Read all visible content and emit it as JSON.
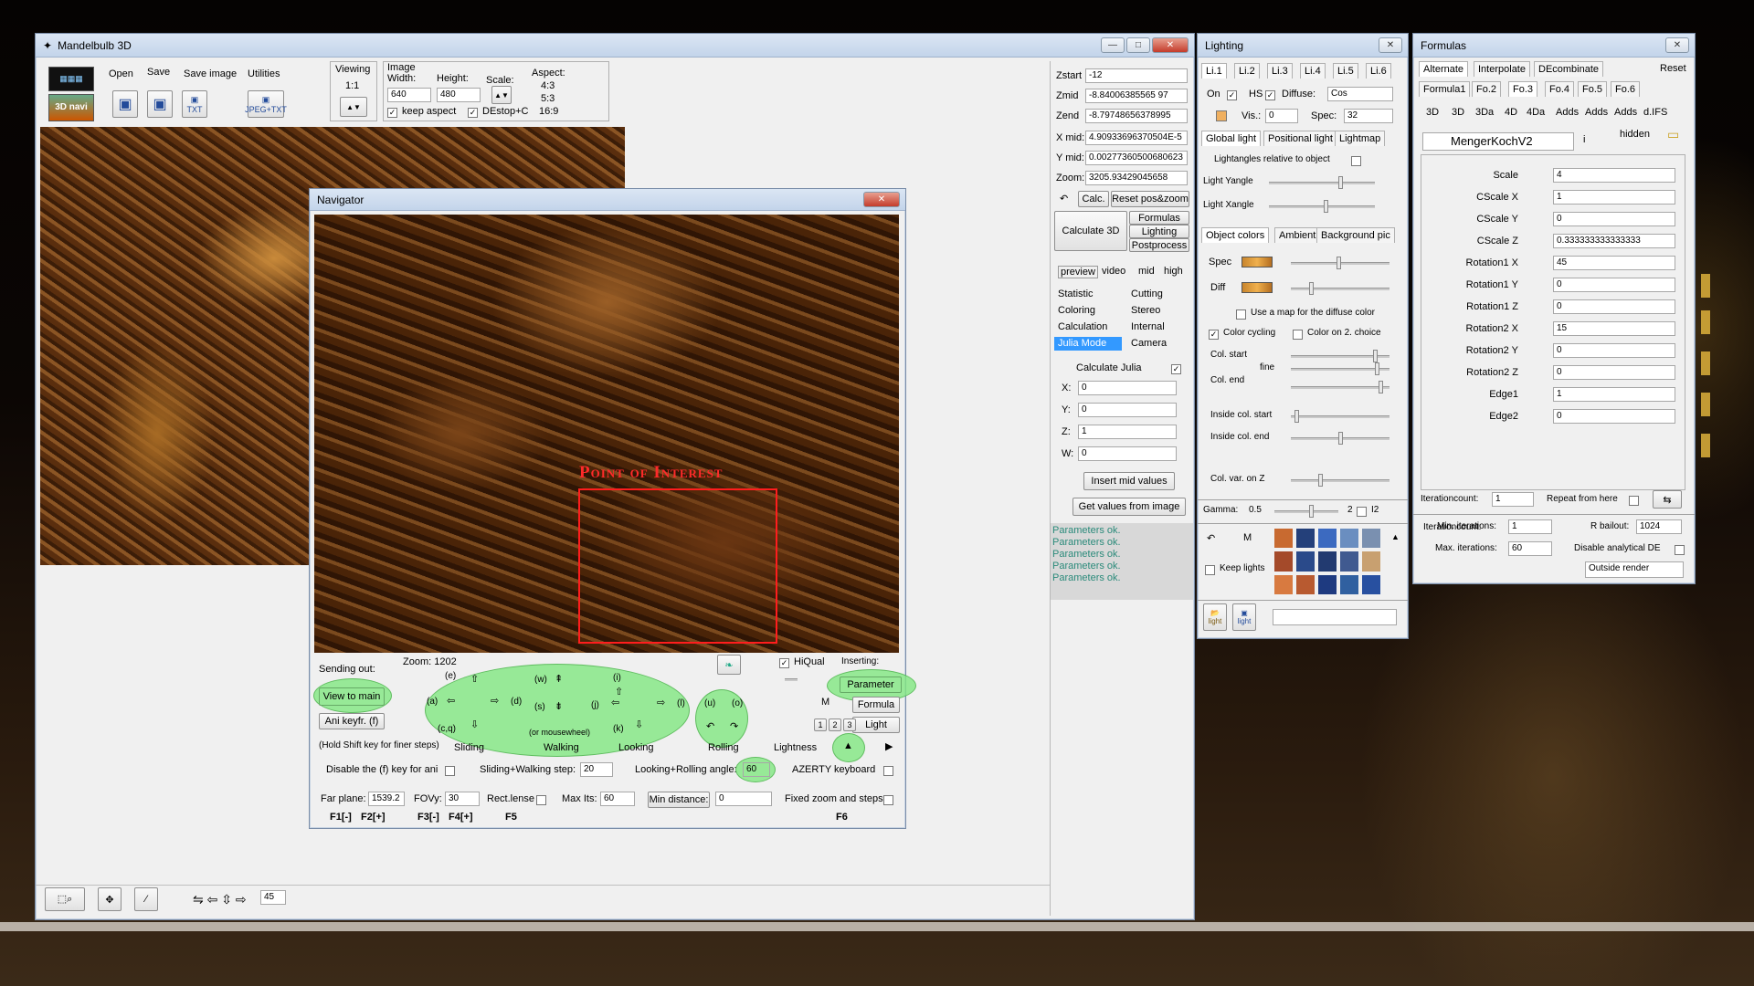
{
  "main": {
    "title": "Mandelbulb 3D",
    "menu": [
      "Open",
      "Save",
      "Save image",
      "Utilities"
    ],
    "viewing_label": "Viewing",
    "viewing_ratio": "1:1",
    "image": {
      "label": "Image",
      "width_label": "Width:",
      "height_label": "Height:",
      "scale_label": "Scale:",
      "aspect_label": "Aspect:",
      "width": "640",
      "height": "480",
      "aspects": [
        "4:3",
        "5:3",
        "16:9"
      ],
      "keep_aspect": "keep aspect",
      "desktop": "DEstop+C"
    },
    "small_icon_labels": [
      "TXT",
      "JPEG+TXT"
    ],
    "bottom_value": "45"
  },
  "coords": {
    "zstart_label": "Zstart",
    "zstart": "-12",
    "zmid_label": "Zmid",
    "zmid": "-8.84006385565 97",
    "zend_label": "Zend",
    "zend": "-8.79748656378995",
    "xmid_label": "X mid:",
    "xmid": "4.90933696370504E-5",
    "ymid_label": "Y mid:",
    "ymid": "0.00277360500680623",
    "zoom_label": "Zoom:",
    "zoom": "3205.93429045658",
    "calc": "Calc.",
    "reset": "Reset pos&zoom",
    "calc3d": "Calculate 3D",
    "side_buttons": [
      "Formulas",
      "Lighting",
      "Postprocess"
    ],
    "quality": [
      "preview",
      "video",
      "mid",
      "high"
    ],
    "tabs_left": [
      "Statistic",
      "Coloring",
      "Calculation",
      "Julia Mode"
    ],
    "tabs_right": [
      "Cutting",
      "Stereo",
      "Internal",
      "Camera"
    ],
    "calc_julia": "Calculate Julia",
    "jx": "X:",
    "jy": "Y:",
    "jz": "Z:",
    "jw": "W:",
    "jxv": "0",
    "jyv": "0",
    "jzv": "1",
    "jwv": "0",
    "insert_mid": "Insert mid values",
    "get_values": "Get values from image",
    "status": [
      "Parameters ok.",
      "Parameters ok.",
      "Parameters ok.",
      "Parameters ok.",
      "Parameters ok."
    ]
  },
  "navigator": {
    "title": "Navigator",
    "poi": "Point of Interest",
    "sending": "Sending out:",
    "zoom": "Zoom: 1202",
    "view_main": "View to main",
    "ani": "Ani keyfr. (f)",
    "hold": "(Hold Shift key for finer steps)",
    "groups": [
      "Sliding",
      "Walking",
      "Looking",
      "Rolling",
      "Lightness"
    ],
    "keys": [
      "(e)",
      "(a)",
      "(d)",
      "(c,q)",
      "(w)",
      "(s)",
      "(or mousewheel)",
      "(i)",
      "(j)",
      "(l)",
      "(k)",
      "(u)",
      "(o)"
    ],
    "hiqual": "HiQual",
    "inserting": "Inserting:",
    "parameter": "Parameter",
    "formula": "Formula",
    "light": "Light",
    "m": "M",
    "nums": [
      "1",
      "2",
      "3"
    ],
    "disable_f": "Disable the (f) key for ani",
    "slide_step_label": "Sliding+Walking step:",
    "slide_step": "20",
    "look_angle_label": "Looking+Rolling angle:",
    "look_angle": "60",
    "azerty": "AZERTY keyboard",
    "far_label": "Far plane:",
    "far": "1539.2",
    "fovy_label": "FOVy:",
    "fovy": "30",
    "rectlense": "Rect.lense",
    "maxits_label": "Max Its:",
    "maxits": "60",
    "mindist": "Min distance:",
    "mindist_v": "0",
    "fixed": "Fixed zoom and steps",
    "fkeys": [
      "F1[-]",
      "F2[+]",
      "F3[-]",
      "F4[+]",
      "F5",
      "F6"
    ]
  },
  "lighting": {
    "title": "Lighting",
    "tabs": [
      "Li.1",
      "Li.2",
      "Li.3",
      "Li.4",
      "Li.5",
      "Li.6"
    ],
    "on": "On",
    "hs": "HS",
    "diffuse_label": "Diffuse:",
    "diffuse": "Cos",
    "vis": "Vis.:",
    "vis_v": "0",
    "spec_label": "Spec:",
    "spec_v": "32",
    "subtabs": [
      "Global light",
      "Positional light",
      "Lightmap"
    ],
    "rel": "Lightangles relative to object",
    "yangle": "Light Yangle",
    "xangle": "Light Xangle",
    "tabs2": [
      "Object colors",
      "Ambient",
      "Background pic"
    ],
    "spec": "Spec",
    "diff": "Diff",
    "usemap": "Use a map for the diffuse color",
    "cycling": "Color cycling",
    "color2": "Color on 2. choice",
    "colstart": "Col. start",
    "fine": "fine",
    "colend": "Col. end",
    "incolstart": "Inside col. start",
    "incolend": "Inside col. end",
    "colvar": "Col. var. on Z",
    "gamma": "Gamma:",
    "gamma_v": "0.5",
    "gamma2": "2",
    "i2": "I2",
    "m": "M",
    "keep": "Keep lights",
    "btn_light": "light"
  },
  "formulas": {
    "title": "Formulas",
    "tabs": [
      "Alternate",
      "Interpolate",
      "DEcombinate"
    ],
    "reset": "Reset",
    "ftabs": [
      "Formula1",
      "Fo.2",
      "Fo.3",
      "Fo.4",
      "Fo.5",
      "Fo.6"
    ],
    "types": [
      "3D",
      "3D",
      "3Da",
      "4D",
      "4Da",
      "Adds",
      "Adds",
      "Adds",
      "d.IFS"
    ],
    "name": "MengerKochV2",
    "info": "i",
    "hidden": "hidden",
    "params": [
      {
        "k": "Scale",
        "v": "4"
      },
      {
        "k": "CScale X",
        "v": "1"
      },
      {
        "k": "CScale Y",
        "v": "0"
      },
      {
        "k": "CScale Z",
        "v": "0.333333333333333"
      },
      {
        "k": "Rotation1 X",
        "v": "45"
      },
      {
        "k": "Rotation1 Y",
        "v": "0"
      },
      {
        "k": "Rotation1 Z",
        "v": "0"
      },
      {
        "k": "Rotation2 X",
        "v": "15"
      },
      {
        "k": "Rotation2 Y",
        "v": "0"
      },
      {
        "k": "Rotation2 Z",
        "v": "0"
      },
      {
        "k": "Edge1",
        "v": "1"
      },
      {
        "k": "Edge2",
        "v": "0"
      }
    ],
    "itcount_label": "Iterationcount:",
    "itcount": "1",
    "repeat": "Repeat from here",
    "min_it_label": "Min. iterations:",
    "min_it": "1",
    "rbail_label": "R bailout:",
    "rbail": "1024",
    "max_it_label": "Max. iterations:",
    "max_it": "60",
    "disable_de": "Disable analytical DE",
    "outside": "Outside render"
  },
  "colors": {
    "accent": "#3399ff",
    "green": "#82e682",
    "fractal": "#6b3d16",
    "poi_red": "#e02020"
  }
}
